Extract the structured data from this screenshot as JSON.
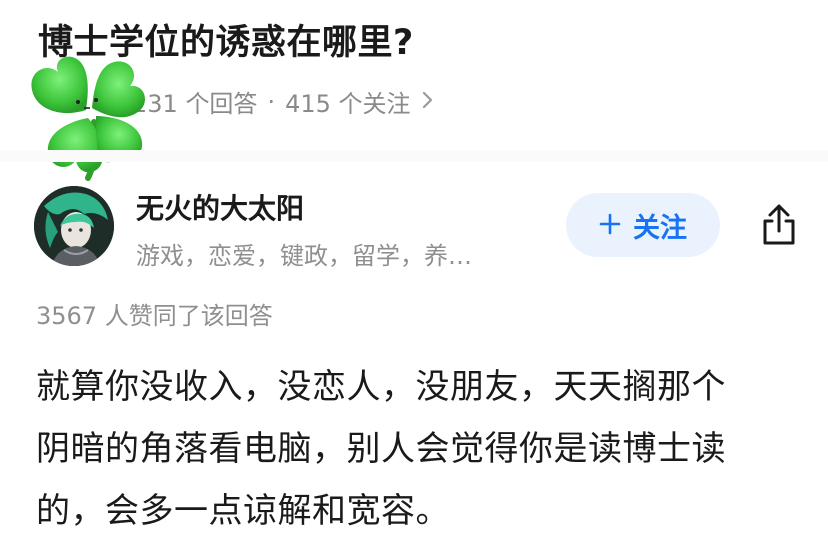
{
  "question": {
    "title": "博士学位的诱惑在哪里?",
    "answer_count": "231 个回答",
    "separator": "·",
    "follower_count": "415 个关注",
    "chevron_icon": "chevron-right-icon"
  },
  "sticker": {
    "icon": "four-leaf-clover-icon",
    "color": "#3cc43a"
  },
  "author": {
    "name": "无火的大太阳",
    "bio": "游戏，恋爱，键政，留学，养…",
    "avatar_icon": "avatar"
  },
  "actions": {
    "follow_label": "关注",
    "follow_icon": "plus-icon",
    "share_icon": "share-icon",
    "accent": "#1772f6"
  },
  "answer": {
    "votes": "3567 人赞同了该回答",
    "lines": [
      "就算你没收入，没恋人，没朋友，天天搁那个",
      "阴暗的角落看电脑，别人会觉得你是读博士读",
      "的，会多一点谅解和宽容。"
    ]
  }
}
